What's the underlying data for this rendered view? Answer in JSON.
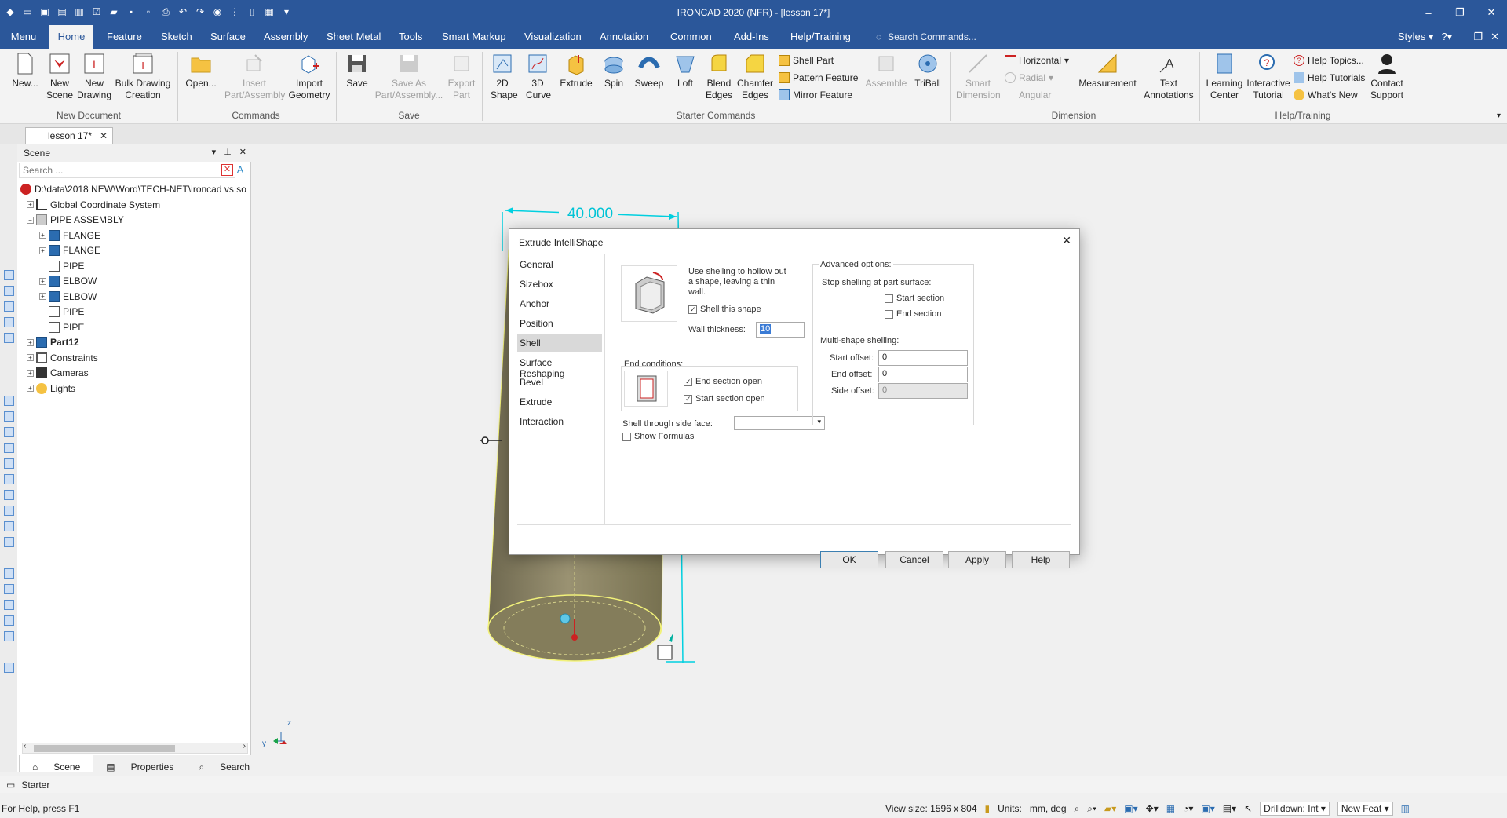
{
  "window": {
    "title": "IRONCAD 2020 (NFR) - [lesson 17*]",
    "controls": [
      "–",
      "❐",
      "✕"
    ]
  },
  "menubar": {
    "tabs": [
      "Menu",
      "Home",
      "Feature",
      "Sketch",
      "Surface",
      "Assembly",
      "Sheet Metal",
      "Tools",
      "Smart Markup",
      "Visualization",
      "Annotation",
      "Common",
      "Add-Ins",
      "Help/Training"
    ],
    "active": "Home",
    "search_placeholder": "Search Commands...",
    "styles_label": "Styles"
  },
  "ribbon": {
    "new_document": {
      "label": "New Document",
      "new": "New...",
      "new_scene": "New Scene",
      "new_drawing": "New Drawing",
      "bulk_drawing": "Bulk Drawing Creation"
    },
    "commands": {
      "label": "Commands",
      "open": "Open...",
      "insert": "Insert Part/Assembly",
      "import": "Import Geometry"
    },
    "save": {
      "label": "Save",
      "save": "Save",
      "save_as": "Save As Part/Assembly...",
      "export": "Export Part"
    },
    "starter": {
      "label": "Starter Commands",
      "shape2d": "2D Shape",
      "curve3d": "3D Curve",
      "extrude": "Extrude",
      "spin": "Spin",
      "sweep": "Sweep",
      "loft": "Loft",
      "blend": "Blend Edges",
      "chamfer": "Chamfer Edges",
      "shell_part": "Shell Part",
      "pattern_feature": "Pattern Feature",
      "mirror_feature": "Mirror Feature",
      "assemble": "Assemble",
      "triball": "TriBall"
    },
    "dimension": {
      "label": "Dimension",
      "smart": "Smart Dimension",
      "horizontal": "Horizontal",
      "radial": "Radial",
      "angular": "Angular",
      "measurement": "Measurement",
      "text": "Text Annotations"
    },
    "help": {
      "label": "Help/Training",
      "learning": "Learning Center",
      "interactive": "Interactive Tutorial",
      "topics": "Help Topics...",
      "tutorials": "Help Tutorials",
      "whats_new": "What's New",
      "contact": "Contact Support"
    }
  },
  "doc_tab": "lesson 17*",
  "scene": {
    "title": "Scene",
    "search_placeholder": "Search ...",
    "tree": [
      {
        "label": "D:\\data\\2018 NEW\\Word\\TECH-NET\\ironcad vs so",
        "level": 0,
        "expander": "",
        "bold": false
      },
      {
        "label": "Global Coordinate System",
        "level": 1,
        "expander": "+",
        "bold": false
      },
      {
        "label": "PIPE ASSEMBLY",
        "level": 1,
        "expander": "−",
        "bold": false
      },
      {
        "label": "FLANGE",
        "level": 2,
        "expander": "+",
        "bold": false
      },
      {
        "label": "FLANGE",
        "level": 2,
        "expander": "+",
        "bold": false
      },
      {
        "label": "PIPE",
        "level": 2,
        "expander": "",
        "bold": false
      },
      {
        "label": "ELBOW",
        "level": 2,
        "expander": "+",
        "bold": false
      },
      {
        "label": "ELBOW",
        "level": 2,
        "expander": "+",
        "bold": false
      },
      {
        "label": "PIPE",
        "level": 2,
        "expander": "",
        "bold": false
      },
      {
        "label": "PIPE",
        "level": 2,
        "expander": "",
        "bold": false
      },
      {
        "label": "Part12",
        "level": 1,
        "expander": "+",
        "bold": true
      },
      {
        "label": "Constraints",
        "level": 1,
        "expander": "+",
        "bold": false
      },
      {
        "label": "Cameras",
        "level": 1,
        "expander": "+",
        "bold": false
      },
      {
        "label": "Lights",
        "level": 1,
        "expander": "+",
        "bold": false
      }
    ],
    "tabs": [
      "Scene",
      "Properties",
      "Search"
    ]
  },
  "viewport": {
    "dimension": "40.000",
    "axis_z": "z",
    "axis_y": "y"
  },
  "dialog": {
    "title": "Extrude IntelliShape",
    "nav": [
      "General",
      "Sizebox",
      "Anchor",
      "Position",
      "Shell",
      "Surface Reshaping",
      "Bevel",
      "Extrude",
      "Interaction"
    ],
    "nav_selected": "Shell",
    "description": "Use shelling to hollow out a shape, leaving a thin wall.",
    "shell_this_shape": "Shell this shape",
    "wall_thickness_label": "Wall thickness:",
    "wall_thickness_value": "10",
    "end_conditions_label": "End conditions:",
    "end_section_open": "End section open",
    "start_section_open": "Start section open",
    "shell_through_label": "Shell through side face:",
    "show_formulas": "Show Formulas",
    "advanced_label": "Advanced options:",
    "stop_shelling_label": "Stop shelling at part surface:",
    "start_section": "Start section",
    "end_section": "End section",
    "multishape_label": "Multi-shape shelling:",
    "start_offset_label": "Start offset:",
    "start_offset_value": "0",
    "end_offset_label": "End offset:",
    "end_offset_value": "0",
    "side_offset_label": "Side offset:",
    "side_offset_value": "0",
    "buttons": {
      "ok": "OK",
      "cancel": "Cancel",
      "apply": "Apply",
      "help": "Help"
    }
  },
  "starter_bar": "Starter",
  "status": {
    "help": "For Help, press F1",
    "view_size": "View size: 1596 x  804",
    "units_label": "Units:",
    "units_value": "mm, deg",
    "drilldown": "Drilldown: Int",
    "new_feat": "New Feat"
  },
  "colors": {
    "title_bar": "#2b579a",
    "dialog_bg": "#f0f0f0",
    "dimension": "#00d0e0",
    "pipe": "#857e5e"
  }
}
